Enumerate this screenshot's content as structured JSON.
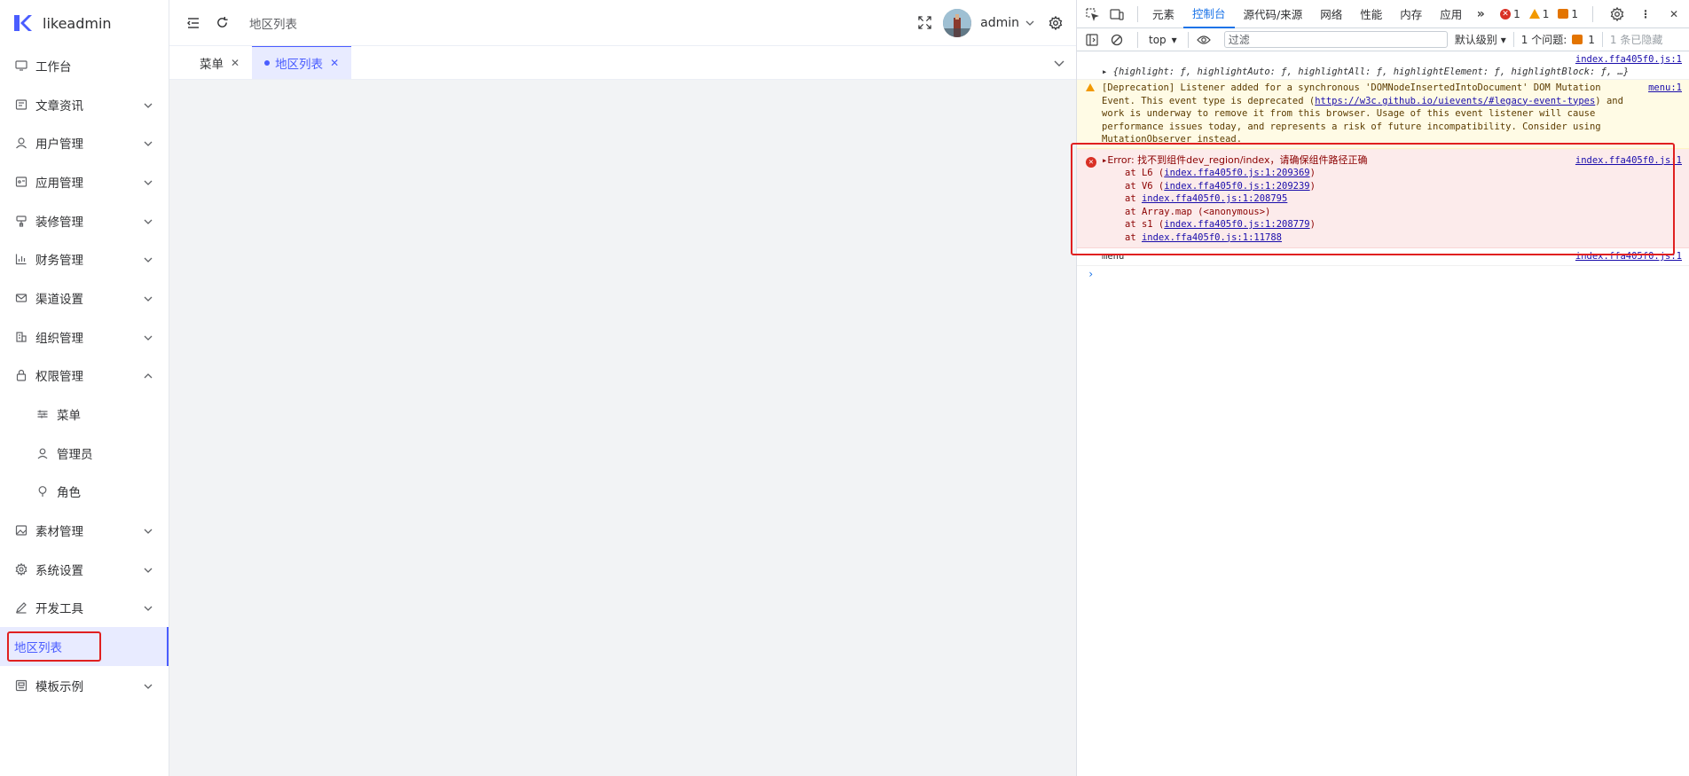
{
  "app": {
    "logo_text": "likeadmin",
    "breadcrumb": "地区列表",
    "user_name": "admin",
    "sidebar": {
      "items": [
        {
          "label": "工作台",
          "icon": "monitor-icon",
          "arrow": false
        },
        {
          "label": "文章资讯",
          "icon": "article-icon",
          "arrow": true
        },
        {
          "label": "用户管理",
          "icon": "user-icon",
          "arrow": true
        },
        {
          "label": "应用管理",
          "icon": "app-icon",
          "arrow": true
        },
        {
          "label": "装修管理",
          "icon": "decorate-icon",
          "arrow": true
        },
        {
          "label": "财务管理",
          "icon": "chart-icon",
          "arrow": true
        },
        {
          "label": "渠道设置",
          "icon": "mail-icon",
          "arrow": true
        },
        {
          "label": "组织管理",
          "icon": "building-icon",
          "arrow": true
        },
        {
          "label": "权限管理",
          "icon": "lock-icon",
          "arrow": true,
          "expanded": true
        },
        {
          "label": "菜单",
          "icon": "sliders-icon",
          "sub": true
        },
        {
          "label": "管理员",
          "icon": "person-icon",
          "sub": true
        },
        {
          "label": "角色",
          "icon": "bulb-icon",
          "sub": true
        },
        {
          "label": "素材管理",
          "icon": "image-icon",
          "arrow": true
        },
        {
          "label": "系统设置",
          "icon": "gear-icon",
          "arrow": true
        },
        {
          "label": "开发工具",
          "icon": "pen-icon",
          "arrow": true
        },
        {
          "label": "地区列表",
          "icon": "",
          "active": true
        },
        {
          "label": "模板示例",
          "icon": "template-icon",
          "arrow": true
        }
      ]
    },
    "tabs": [
      {
        "label": "菜单",
        "active": false
      },
      {
        "label": "地区列表",
        "active": true
      }
    ]
  },
  "devtools": {
    "tabs": [
      "元素",
      "控制台",
      "源代码/来源",
      "网络",
      "性能",
      "内存",
      "应用"
    ],
    "active_tab": "控制台",
    "counts": {
      "errors": "1",
      "warnings": "1",
      "info": "1"
    },
    "context": "top",
    "filter_placeholder": "过滤",
    "level": "默认级别",
    "issues_label": "1 个问题:",
    "issues_count": "1",
    "hidden": "1 条已隐藏",
    "console": {
      "src1": "index.ffa405f0.js:1",
      "obj_line": "{highlight: ƒ, highlightAuto: ƒ, highlightAll: ƒ, highlightElement: ƒ, highlightBlock: ƒ, …}",
      "warn_src": "menu:1",
      "warn_text_a": "[Deprecation] Listener added for a synchronous 'DOMNodeInsertedIntoDocument' DOM Mutation Event. This event type is deprecated (",
      "warn_link": "https://w3c.github.io/uievents/#legacy-event-types",
      "warn_text_b": ") and work is underway to remove it from this browser. Usage of this event listener will cause performance issues today, and represents a risk of future incompatibility. Consider using MutationObserver instead.",
      "err_src": "index.ffa405f0.js:1",
      "err_title": "Error: 找不到组件dev_region/index，请确保组件路径正确",
      "stack": [
        {
          "pre": "at L6 (",
          "link": "index.ffa405f0.js:1:209369",
          "post": ")"
        },
        {
          "pre": "at V6 (",
          "link": "index.ffa405f0.js:1:209239",
          "post": ")"
        },
        {
          "pre": "at ",
          "link": "index.ffa405f0.js:1:208795",
          "post": ""
        },
        {
          "pre": "at Array.map (<anonymous>)",
          "link": "",
          "post": ""
        },
        {
          "pre": "at s1 (",
          "link": "index.ffa405f0.js:1:208779",
          "post": ")"
        },
        {
          "pre": "at ",
          "link": "index.ffa405f0.js:1:11788",
          "post": ""
        }
      ],
      "menu_text": "menu",
      "menu_src": "index.ffa405f0.js:1",
      "prompt": "›"
    }
  },
  "colors": {
    "accent": "#4a5dff",
    "highlight_box": "#e02020",
    "devtools_accent": "#1a73e8"
  }
}
